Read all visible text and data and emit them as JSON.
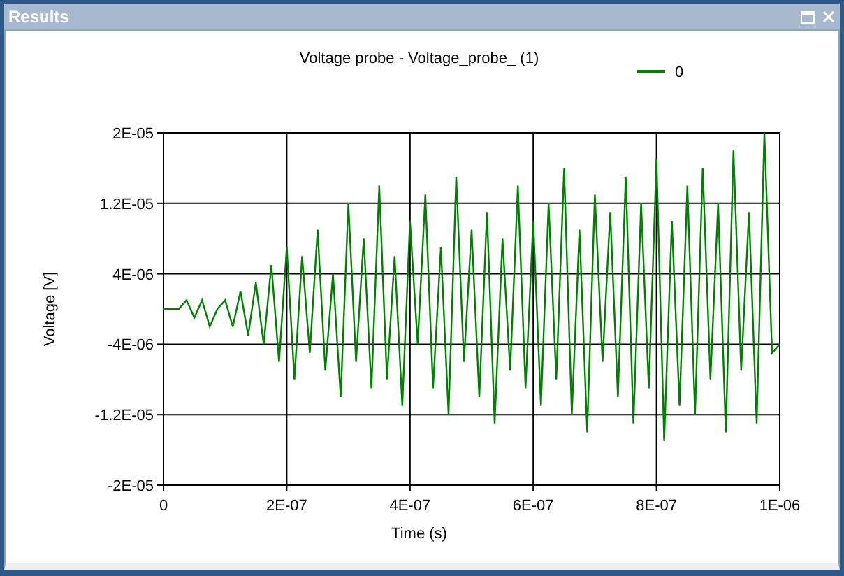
{
  "window": {
    "title": "Results"
  },
  "chart": {
    "chart_data": {
      "type": "line",
      "grid": true,
      "title": "Voltage probe - Voltage_probe_ (1)",
      "xlabel": "Time (s)",
      "ylabel": "Voltage [V]",
      "x": [
        0,
        1.25e-08,
        2.5e-08,
        3.75e-08,
        5e-08,
        6.25e-08,
        7.5e-08,
        8.75e-08,
        1e-07,
        1.125e-07,
        1.25e-07,
        1.375e-07,
        1.5e-07,
        1.625e-07,
        1.75e-07,
        1.875e-07,
        2e-07,
        2.125e-07,
        2.25e-07,
        2.375e-07,
        2.5e-07,
        2.625e-07,
        2.75e-07,
        2.875e-07,
        3e-07,
        3.125e-07,
        3.25e-07,
        3.375e-07,
        3.5e-07,
        3.625e-07,
        3.75e-07,
        3.875e-07,
        4e-07,
        4.125e-07,
        4.25e-07,
        4.375e-07,
        4.5e-07,
        4.625e-07,
        4.75e-07,
        4.875e-07,
        5e-07,
        5.125e-07,
        5.25e-07,
        5.375e-07,
        5.5e-07,
        5.625e-07,
        5.75e-07,
        5.875e-07,
        6e-07,
        6.125e-07,
        6.25e-07,
        6.375e-07,
        6.5e-07,
        6.625e-07,
        6.75e-07,
        6.875e-07,
        7e-07,
        7.125e-07,
        7.25e-07,
        7.375e-07,
        7.5e-07,
        7.625e-07,
        7.75e-07,
        7.875e-07,
        8e-07,
        8.125e-07,
        8.25e-07,
        8.375e-07,
        8.5e-07,
        8.625e-07,
        8.75e-07,
        8.875e-07,
        9e-07,
        9.125e-07,
        9.25e-07,
        9.375e-07,
        9.5e-07,
        9.625e-07,
        9.75e-07,
        9.875e-07,
        1e-06
      ],
      "series": [
        {
          "name": "0",
          "color": "#008000",
          "values": [
            0,
            0,
            0,
            1e-06,
            -1e-06,
            1e-06,
            -2e-06,
            0,
            1e-06,
            -2e-06,
            2e-06,
            -3e-06,
            3e-06,
            -4e-06,
            5e-06,
            -6e-06,
            7e-06,
            -8e-06,
            6e-06,
            -5e-06,
            9e-06,
            -7e-06,
            4e-06,
            -1e-05,
            1.2e-05,
            -6e-06,
            8e-06,
            -9e-06,
            1.4e-05,
            -8e-06,
            6e-06,
            -1.1e-05,
            1e-05,
            -4e-06,
            1.3e-05,
            -9e-06,
            7e-06,
            -1.2e-05,
            1.5e-05,
            -6e-06,
            9e-06,
            -1e-05,
            1.1e-05,
            -1.3e-05,
            8e-06,
            -7e-06,
            1.4e-05,
            -9e-06,
            1e-05,
            -1.1e-05,
            1.2e-05,
            -8e-06,
            1.6e-05,
            -1.2e-05,
            9e-06,
            -1.4e-05,
            1.3e-05,
            -6e-06,
            1.1e-05,
            -1e-05,
            1.5e-05,
            -1.3e-05,
            1.2e-05,
            -9e-06,
            1.7e-05,
            -1.5e-05,
            1e-05,
            -1.1e-05,
            1.4e-05,
            -1.2e-05,
            1.6e-05,
            -8e-06,
            1.2e-05,
            -1.4e-05,
            1.8e-05,
            -7e-06,
            1.1e-05,
            -1.3e-05,
            2e-05,
            -5e-06,
            -4e-06
          ]
        }
      ],
      "xlim": [
        0,
        1e-06
      ],
      "ylim": [
        -2e-05,
        2e-05
      ],
      "xticks": [
        {
          "value": 0,
          "label": "0"
        },
        {
          "value": 2e-07,
          "label": "2E-07"
        },
        {
          "value": 4e-07,
          "label": "4E-07"
        },
        {
          "value": 6e-07,
          "label": "6E-07"
        },
        {
          "value": 8e-07,
          "label": "8E-07"
        },
        {
          "value": 1e-06,
          "label": "1E-06"
        }
      ],
      "yticks": [
        {
          "value": -2e-05,
          "label": "-2E-05"
        },
        {
          "value": -1.2e-05,
          "label": "-1.2E-05"
        },
        {
          "value": -4e-06,
          "label": "-4E-06"
        },
        {
          "value": 4e-06,
          "label": "4E-06"
        },
        {
          "value": 1.2e-05,
          "label": "1.2E-05"
        },
        {
          "value": 2e-05,
          "label": "2E-05"
        }
      ]
    }
  }
}
